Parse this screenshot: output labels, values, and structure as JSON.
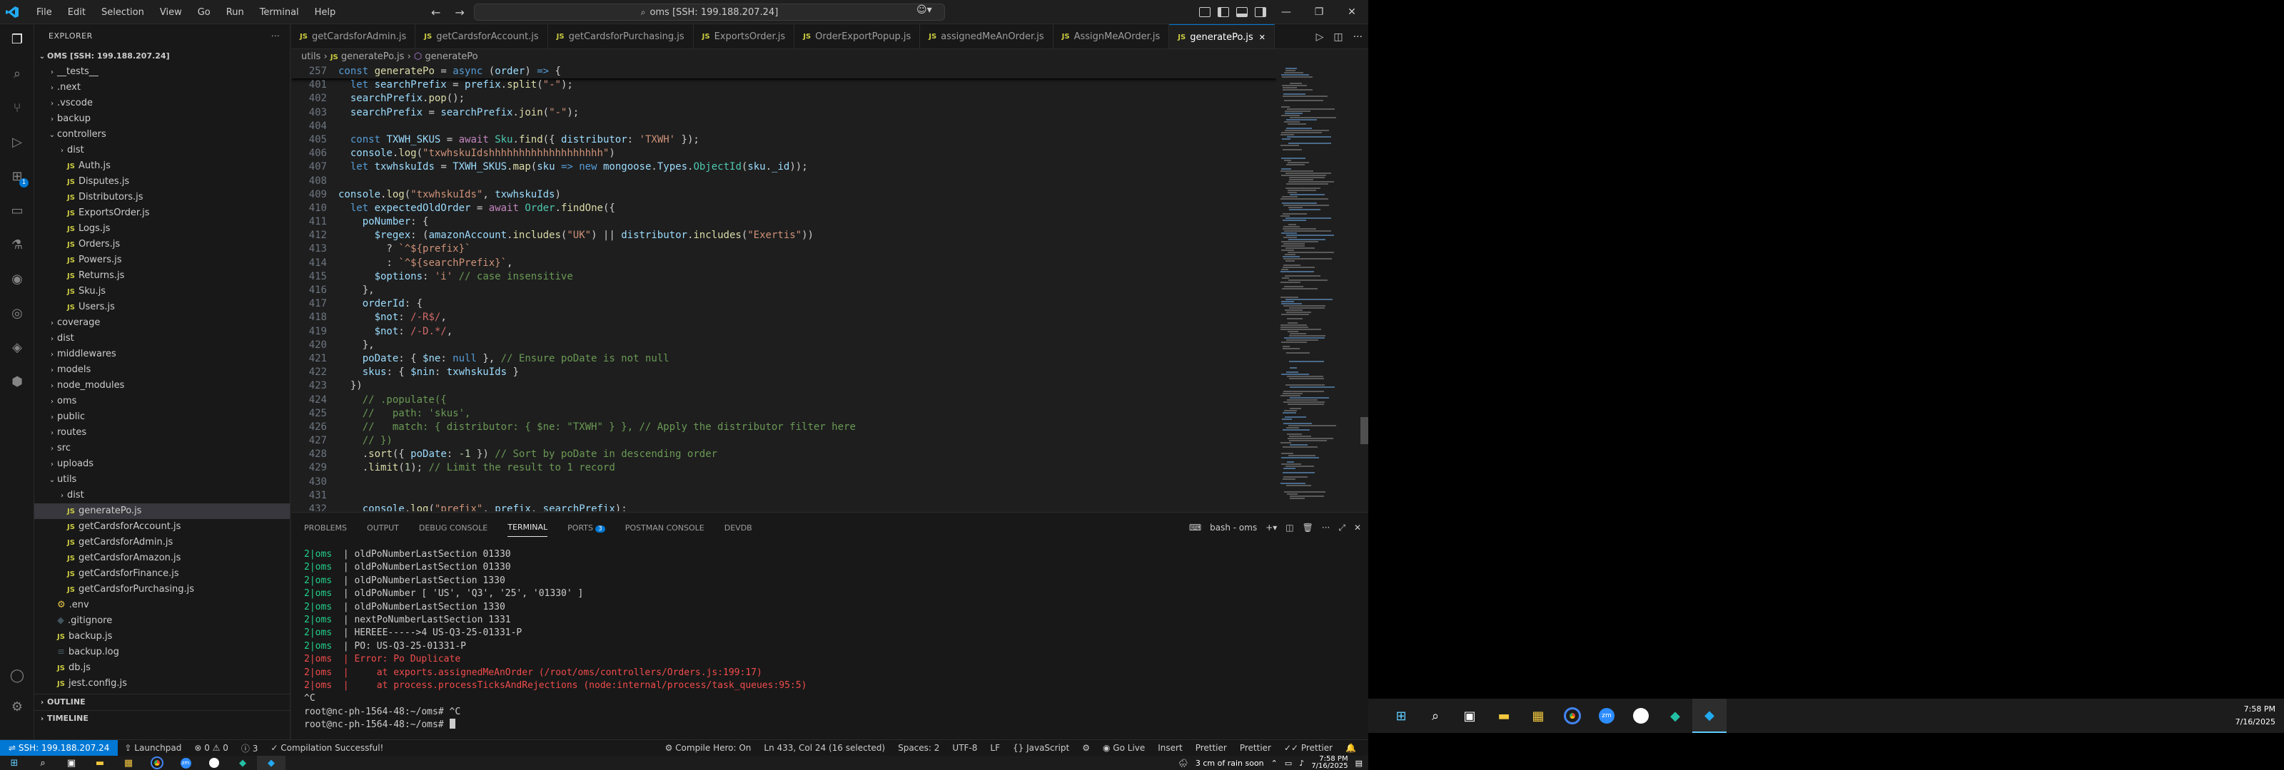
{
  "titlebar": {
    "menu": [
      "File",
      "Edit",
      "Selection",
      "View",
      "Go",
      "Run",
      "Terminal",
      "Help"
    ],
    "command_center": "oms [SSH: 199.188.207.24]"
  },
  "explorer": {
    "title": "EXPLORER",
    "root": "OMS [SSH: 199.188.207.24]",
    "items": [
      {
        "label": "__tests__",
        "depth": 1,
        "type": "folder"
      },
      {
        "label": ".next",
        "depth": 1,
        "type": "folder"
      },
      {
        "label": ".vscode",
        "depth": 1,
        "type": "folder"
      },
      {
        "label": "backup",
        "depth": 1,
        "type": "folder"
      },
      {
        "label": "controllers",
        "depth": 1,
        "type": "folder-open"
      },
      {
        "label": "dist",
        "depth": 2,
        "type": "folder"
      },
      {
        "label": "Auth.js",
        "depth": 2,
        "type": "js"
      },
      {
        "label": "Disputes.js",
        "depth": 2,
        "type": "js"
      },
      {
        "label": "Distributors.js",
        "depth": 2,
        "type": "js"
      },
      {
        "label": "ExportsOrder.js",
        "depth": 2,
        "type": "js"
      },
      {
        "label": "Logs.js",
        "depth": 2,
        "type": "js"
      },
      {
        "label": "Orders.js",
        "depth": 2,
        "type": "js"
      },
      {
        "label": "Powers.js",
        "depth": 2,
        "type": "js"
      },
      {
        "label": "Returns.js",
        "depth": 2,
        "type": "js"
      },
      {
        "label": "Sku.js",
        "depth": 2,
        "type": "js"
      },
      {
        "label": "Users.js",
        "depth": 2,
        "type": "js"
      },
      {
        "label": "coverage",
        "depth": 1,
        "type": "folder"
      },
      {
        "label": "dist",
        "depth": 1,
        "type": "folder"
      },
      {
        "label": "middlewares",
        "depth": 1,
        "type": "folder"
      },
      {
        "label": "models",
        "depth": 1,
        "type": "folder"
      },
      {
        "label": "node_modules",
        "depth": 1,
        "type": "folder"
      },
      {
        "label": "oms",
        "depth": 1,
        "type": "folder"
      },
      {
        "label": "public",
        "depth": 1,
        "type": "folder"
      },
      {
        "label": "routes",
        "depth": 1,
        "type": "folder"
      },
      {
        "label": "src",
        "depth": 1,
        "type": "folder"
      },
      {
        "label": "uploads",
        "depth": 1,
        "type": "folder"
      },
      {
        "label": "utils",
        "depth": 1,
        "type": "folder-open"
      },
      {
        "label": "dist",
        "depth": 2,
        "type": "folder"
      },
      {
        "label": "generatePo.js",
        "depth": 2,
        "type": "js",
        "selected": true
      },
      {
        "label": "getCardsforAccount.js",
        "depth": 2,
        "type": "js"
      },
      {
        "label": "getCardsforAdmin.js",
        "depth": 2,
        "type": "js"
      },
      {
        "label": "getCardsforAmazon.js",
        "depth": 2,
        "type": "js"
      },
      {
        "label": "getCardsforFinance.js",
        "depth": 2,
        "type": "js"
      },
      {
        "label": "getCardsforPurchasing.js",
        "depth": 2,
        "type": "js"
      },
      {
        "label": ".env",
        "depth": 1,
        "type": "env"
      },
      {
        "label": ".gitignore",
        "depth": 1,
        "type": "git"
      },
      {
        "label": "backup.js",
        "depth": 1,
        "type": "js"
      },
      {
        "label": "backup.log",
        "depth": 1,
        "type": "log"
      },
      {
        "label": "db.js",
        "depth": 1,
        "type": "js"
      },
      {
        "label": "jest.config.js",
        "depth": 1,
        "type": "js"
      }
    ],
    "outline": "OUTLINE",
    "timeline": "TIMELINE"
  },
  "tabs": [
    {
      "label": "getCardsforAdmin.js"
    },
    {
      "label": "getCardsforAccount.js"
    },
    {
      "label": "getCardsforPurchasing.js"
    },
    {
      "label": "ExportsOrder.js"
    },
    {
      "label": "OrderExportPopup.js"
    },
    {
      "label": "assignedMeAnOrder.js"
    },
    {
      "label": "AssignMeAOrder.js"
    },
    {
      "label": "generatePo.js",
      "active": true
    }
  ],
  "breadcrumb": {
    "folder": "utils",
    "file": "generatePo.js",
    "symbol": "generatePo"
  },
  "code": {
    "sticky": {
      "num": "257",
      "html": "<span class='kw'>const</span> <span class='fn'>generatePo</span> = <span class='kw'>async</span> (<span class='var'>order</span>) <span class='kw'>=&gt;</span> {"
    },
    "lines": [
      {
        "num": "401",
        "html": "  <span class='kw'>let</span> <span class='var'>searchPrefix</span> = <span class='var'>prefix</span>.<span class='fn'>split</span>(<span class='str'>\"-\"</span>);"
      },
      {
        "num": "402",
        "html": "  <span class='var'>searchPrefix</span>.<span class='fn'>pop</span>();"
      },
      {
        "num": "403",
        "html": "  <span class='var'>searchPrefix</span> = <span class='var'>searchPrefix</span>.<span class='fn'>join</span>(<span class='str'>\"-\"</span>);"
      },
      {
        "num": "404",
        "html": ""
      },
      {
        "num": "405",
        "html": "  <span class='kw'>const</span> <span class='var'>TXWH_SKUS</span> = <span class='ctl'>await</span> <span class='cls'>Sku</span>.<span class='fn'>find</span>({ <span class='var'>distributor</span>: <span class='str'>'TXWH'</span> });"
      },
      {
        "num": "406",
        "html": "  <span class='var'>console</span>.<span class='fn'>log</span>(<span class='str'>\"txwhskuIdshhhhhhhhhhhhhhhhhhh\"</span>)"
      },
      {
        "num": "407",
        "html": "  <span class='kw'>let</span> <span class='var'>txwhskuIds</span> = <span class='var'>TXWH_SKUS</span>.<span class='fn'>map</span>(<span class='var'>sku</span> <span class='kw'>=&gt;</span> <span class='kw'>new</span> <span class='var'>mongoose</span>.<span class='var'>Types</span>.<span class='cls'>ObjectId</span>(<span class='var'>sku</span>.<span class='var'>_id</span>));"
      },
      {
        "num": "408",
        "html": ""
      },
      {
        "num": "409",
        "html": "<span class='var'>console</span>.<span class='fn'>log</span>(<span class='str'>\"txwhskuIds\"</span>, <span class='var'>txwhskuIds</span>)"
      },
      {
        "num": "410",
        "html": "  <span class='kw'>let</span> <span class='var'>expectedOldOrder</span> = <span class='ctl'>await</span> <span class='cls'>Order</span>.<span class='fn'>findOne</span>({"
      },
      {
        "num": "411",
        "html": "    <span class='var'>poNumber</span>: {"
      },
      {
        "num": "412",
        "html": "      <span class='var'>$regex</span>: (<span class='var'>amazonAccount</span>.<span class='fn'>includes</span>(<span class='str'>\"UK\"</span>) || <span class='var'>distributor</span>.<span class='fn'>includes</span>(<span class='str'>\"Exertis\"</span>))"
      },
      {
        "num": "413",
        "html": "        ? <span class='str'>`^${prefix}`</span>"
      },
      {
        "num": "414",
        "html": "        : <span class='str'>`^${searchPrefix}`</span>,"
      },
      {
        "num": "415",
        "html": "      <span class='var'>$options</span>: <span class='str'>'i'</span> <span class='cm'>// case insensitive</span>"
      },
      {
        "num": "416",
        "html": "    },"
      },
      {
        "num": "417",
        "html": "    <span class='var'>orderId</span>: {"
      },
      {
        "num": "418",
        "html": "      <span class='var'>$not</span>: <span class='rx'>/-R$/</span>,"
      },
      {
        "num": "419",
        "html": "      <span class='var'>$not</span>: <span class='rx'>/-D.*/</span>,"
      },
      {
        "num": "420",
        "html": "    },"
      },
      {
        "num": "421",
        "html": "    <span class='var'>poDate</span>: { <span class='var'>$ne</span>: <span class='kw'>null</span> }, <span class='cm'>// Ensure poDate is not null</span>"
      },
      {
        "num": "422",
        "html": "    <span class='var'>skus</span>: { <span class='var'>$nin</span>: <span class='var'>txwhskuIds</span> }"
      },
      {
        "num": "423",
        "html": "  })"
      },
      {
        "num": "424",
        "html": "    <span class='cm'>// .populate({</span>"
      },
      {
        "num": "425",
        "html": "    <span class='cm'>//   path: 'skus',</span>"
      },
      {
        "num": "426",
        "html": "    <span class='cm'>//   match: { distributor: { $ne: \"TXWH\" } }, // Apply the distributor filter here</span>"
      },
      {
        "num": "427",
        "html": "    <span class='cm'>// })</span>"
      },
      {
        "num": "428",
        "html": "    .<span class='fn'>sort</span>({ <span class='var'>poDate</span>: <span class='num'>-1</span> }) <span class='cm'>// Sort by poDate in descending order</span>"
      },
      {
        "num": "429",
        "html": "    .<span class='fn'>limit</span>(<span class='num'>1</span>); <span class='cm'>// Limit the result to 1 record</span>"
      },
      {
        "num": "430",
        "html": ""
      },
      {
        "num": "431",
        "html": ""
      },
      {
        "num": "432",
        "html": "    <span class='var'>console</span>.<span class='fn'>log</span>(<span class='str'>\"prefix\"</span>, <span class='var'>prefix</span>, <span class='var'>searchPrefix</span>);"
      }
    ]
  },
  "panel": {
    "tabs": [
      "PROBLEMS",
      "OUTPUT",
      "DEBUG CONSOLE",
      "TERMINAL",
      "PORTS",
      "POSTMAN CONSOLE",
      "DEVDB"
    ],
    "active": "TERMINAL",
    "ports_badge": "3",
    "shell": "bash - oms",
    "terminal": [
      {
        "pre": "2|oms",
        "err": false,
        "text": "  | oldPoNumberLastSection 01330"
      },
      {
        "pre": "2|oms",
        "err": false,
        "text": "  | oldPoNumberLastSection 01330"
      },
      {
        "pre": "2|oms",
        "err": false,
        "text": "  | oldPoNumberLastSection 1330"
      },
      {
        "pre": "2|oms",
        "err": false,
        "text": "  | oldPoNumber [ 'US', 'Q3', '25', '01330' ]"
      },
      {
        "pre": "2|oms",
        "err": false,
        "text": "  | oldPoNumberLastSection 1330"
      },
      {
        "pre": "2|oms",
        "err": false,
        "text": "  | nextPoNumberLastSection 1331"
      },
      {
        "pre": "2|oms",
        "err": false,
        "text": "  | HEREEE----->4 US-Q3-25-01331-P"
      },
      {
        "pre": "2|oms",
        "err": false,
        "text": "  | PO: US-Q3-25-01331-P"
      },
      {
        "pre": "2|oms",
        "err": true,
        "text": "  | Error: Po Duplicate"
      },
      {
        "pre": "2|oms",
        "err": true,
        "text": "  |     at exports.assignedMeAnOrder (/root/oms/controllers/Orders.js:199:17)"
      },
      {
        "pre": "2|oms",
        "err": true,
        "text": "  |     at process.processTicksAndRejections (node:internal/process/task_queues:95:5)"
      },
      {
        "pre": "",
        "err": false,
        "text": "^C"
      },
      {
        "pre": "",
        "err": false,
        "text": "root@nc-ph-1564-48:~/oms# ^C"
      },
      {
        "pre": "",
        "err": false,
        "text": "root@nc-ph-1564-48:~/oms# ",
        "cursor": true
      }
    ]
  },
  "status": {
    "remote": "SSH: 199.188.207.24",
    "launchpad": "Launchpad",
    "errors": "0",
    "warnings": "0",
    "info": "3",
    "compile": "Compilation Successful!",
    "compile_hero": "Compile Hero: On",
    "cursor": "Ln 433, Col 24 (16 selected)",
    "spaces": "Spaces: 2",
    "encoding": "UTF-8",
    "eol": "LF",
    "language": "JavaScript",
    "golive": "Go Live",
    "insert": "Insert",
    "prettier1": "Prettier",
    "prettier2": "Prettier",
    "prettier3": "Prettier"
  },
  "taskbar": {
    "weather": "3 cm of rain soon",
    "time": "7:58 PM",
    "date": "7/16/2025"
  }
}
